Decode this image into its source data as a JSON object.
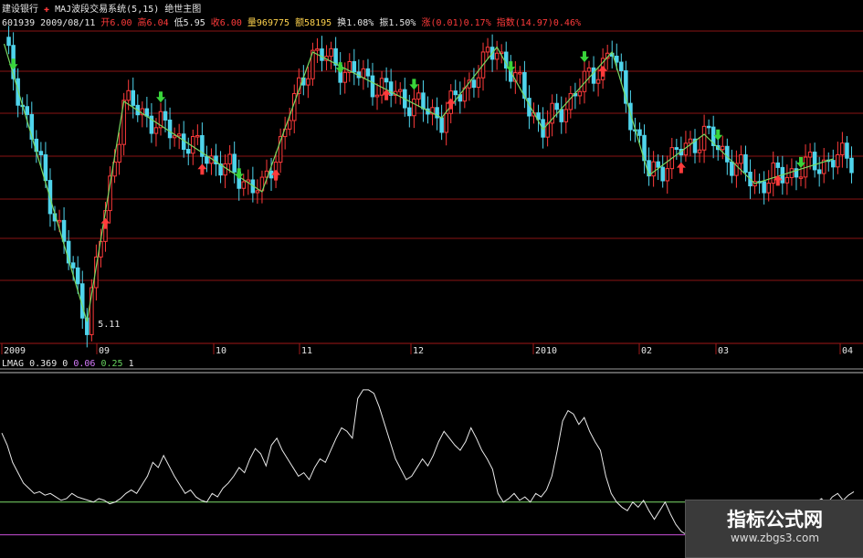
{
  "header": {
    "stock_name": "建设银行",
    "system_name": "MAJ波段交易系统(5,15)",
    "main_chart_name": "绝世主图",
    "code": "601939",
    "date": "2009/08/11",
    "open": "开6.00",
    "high": "高6.04",
    "low": "低5.95",
    "close": "收6.00",
    "volume": "量969775",
    "amount": "额58195",
    "turnover": "换1.08%",
    "amplitude": "振1.50%",
    "change": "涨(0.01)0.17%",
    "index": "指数(14.97)0.46%"
  },
  "sub_header": {
    "name": "LMAG",
    "v1": "0.369",
    "v2": "0",
    "v3": "0.06",
    "v4": "0.25",
    "v5": "1"
  },
  "watermark": {
    "title": "指标公式网",
    "url": "www.zbgs3.com"
  },
  "colors": {
    "up": "#ff3b3b",
    "down": "#4fd4ec",
    "zigzag": "#78d860",
    "lmag_line": "#e8e8e8",
    "green_level": "#7ddc6a",
    "magenta_level": "#c84fd8",
    "grid": "#8a1414"
  },
  "chart_data": [
    {
      "type": "candlestick",
      "title": "",
      "x_labels": [
        "2009",
        "09",
        "10",
        "11",
        "12",
        "2010",
        "02",
        "03",
        "04"
      ],
      "ylim": [
        5.0,
        6.9
      ],
      "annotations": [
        {
          "text": "5.11",
          "value": 5.11
        }
      ],
      "zigzag": [
        {
          "bar": 0,
          "value": 6.8
        },
        {
          "bar": 18,
          "value": 5.11
        },
        {
          "bar": 26,
          "value": 6.45
        },
        {
          "bar": 56,
          "value": 5.9
        },
        {
          "bar": 67,
          "value": 6.75
        },
        {
          "bar": 95,
          "value": 6.35
        },
        {
          "bar": 107,
          "value": 6.78
        },
        {
          "bar": 117,
          "value": 6.28
        },
        {
          "bar": 132,
          "value": 6.75
        },
        {
          "bar": 140,
          "value": 6.0
        },
        {
          "bar": 152,
          "value": 6.25
        },
        {
          "bar": 163,
          "value": 5.95
        },
        {
          "bar": 180,
          "value": 6.1
        }
      ],
      "buy_signals": [
        22,
        43,
        59,
        83,
        97,
        130,
        147,
        168
      ],
      "sell_signals": [
        2,
        34,
        51,
        73,
        89,
        110,
        126,
        173,
        155
      ]
    },
    {
      "type": "line",
      "name": "LMAG",
      "ylim": [
        0,
        1
      ],
      "levels": [
        0.06,
        0.25,
        1
      ],
      "values": [
        0.65,
        0.58,
        0.48,
        0.42,
        0.36,
        0.33,
        0.3,
        0.31,
        0.29,
        0.3,
        0.28,
        0.26,
        0.27,
        0.3,
        0.28,
        0.27,
        0.26,
        0.25,
        0.27,
        0.26,
        0.24,
        0.25,
        0.27,
        0.3,
        0.32,
        0.3,
        0.35,
        0.4,
        0.48,
        0.45,
        0.52,
        0.46,
        0.4,
        0.35,
        0.3,
        0.32,
        0.28,
        0.26,
        0.25,
        0.3,
        0.28,
        0.33,
        0.36,
        0.4,
        0.45,
        0.42,
        0.5,
        0.56,
        0.53,
        0.46,
        0.58,
        0.62,
        0.55,
        0.5,
        0.45,
        0.4,
        0.42,
        0.38,
        0.45,
        0.5,
        0.48,
        0.55,
        0.62,
        0.68,
        0.66,
        0.62,
        0.85,
        0.9,
        0.9,
        0.88,
        0.8,
        0.7,
        0.6,
        0.5,
        0.44,
        0.38,
        0.4,
        0.45,
        0.5,
        0.46,
        0.52,
        0.6,
        0.66,
        0.62,
        0.58,
        0.55,
        0.6,
        0.68,
        0.62,
        0.55,
        0.5,
        0.44,
        0.3,
        0.25,
        0.27,
        0.3,
        0.26,
        0.28,
        0.25,
        0.3,
        0.28,
        0.32,
        0.4,
        0.55,
        0.72,
        0.78,
        0.76,
        0.7,
        0.74,
        0.66,
        0.6,
        0.55,
        0.4,
        0.3,
        0.25,
        0.22,
        0.2,
        0.25,
        0.22,
        0.26,
        0.2,
        0.15,
        0.2,
        0.25,
        0.18,
        0.12,
        0.08,
        0.06,
        0.05,
        0.06,
        0.05,
        0.04,
        0.06,
        0.05,
        0.06,
        0.04,
        0.05,
        0.07,
        0.05,
        0.06,
        0.08,
        0.07,
        0.09,
        0.1,
        0.12,
        0.15,
        0.12,
        0.16,
        0.2,
        0.18,
        0.22,
        0.25,
        0.27,
        0.24,
        0.28,
        0.3,
        0.26,
        0.29,
        0.31
      ]
    }
  ]
}
